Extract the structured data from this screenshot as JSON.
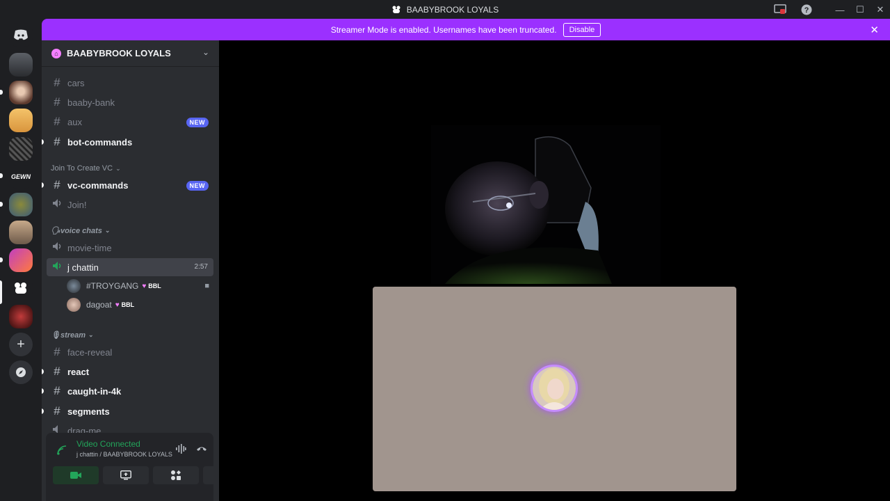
{
  "window": {
    "title": "BAABYBROOK LOYALS"
  },
  "banner": {
    "text": "Streamer Mode is enabled. Usernames have been truncated.",
    "button_label": "Disable"
  },
  "server": {
    "name": "BAABYBROOK LOYALS"
  },
  "channels_top": [
    {
      "name": "cars",
      "unread": false
    },
    {
      "name": "baaby-bank",
      "unread": false
    },
    {
      "name": "aux",
      "unread": false,
      "badge": "NEW"
    },
    {
      "name": "bot-commands",
      "unread": true
    }
  ],
  "category_vc": {
    "label": "Join To Create VC",
    "channels": [
      {
        "name": "vc-commands",
        "type": "text",
        "unread": true,
        "badge": "NEW"
      },
      {
        "name": "Join!",
        "type": "voice"
      }
    ]
  },
  "category_voice": {
    "label": "🗣voice chats",
    "channels": [
      {
        "name": "movie-time"
      },
      {
        "name": "j chattin",
        "timer": "2:57"
      }
    ],
    "users": [
      {
        "name": "#TROYGANG",
        "tag": "BBL"
      },
      {
        "name": "dagoat",
        "tag": "BBL"
      }
    ]
  },
  "category_stream": {
    "label": "🎙stream",
    "channels": [
      {
        "name": "face-reveal",
        "unread": false
      },
      {
        "name": "react",
        "unread": true
      },
      {
        "name": "caught-in-4k",
        "unread": true
      },
      {
        "name": "segments",
        "unread": true
      },
      {
        "name": "drag-me",
        "unread": false
      }
    ]
  },
  "voice_panel": {
    "status": "Video Connected",
    "location": "j chattin / BAABYBROOK LOYALS"
  },
  "colors": {
    "accent": "#9b30ff",
    "connected": "#23a55a",
    "tile_bg": "#a1958e"
  }
}
